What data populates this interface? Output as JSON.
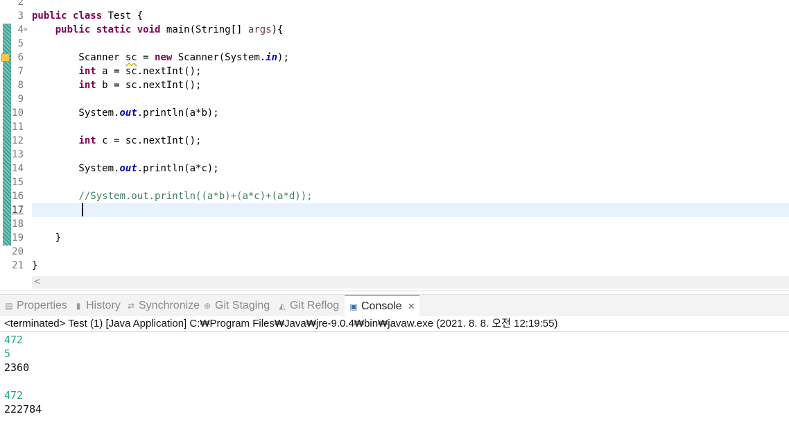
{
  "editor": {
    "lines": [
      {
        "num": "2",
        "code": ""
      },
      {
        "num": "3",
        "code": "public class Test {"
      },
      {
        "num": "4",
        "code": "    public static void main(String[] args){"
      },
      {
        "num": "5",
        "code": ""
      },
      {
        "num": "6",
        "code": "        Scanner sc = new Scanner(System.in);"
      },
      {
        "num": "7",
        "code": "        int a = sc.nextInt();"
      },
      {
        "num": "8",
        "code": "        int b = sc.nextInt();"
      },
      {
        "num": "9",
        "code": ""
      },
      {
        "num": "10",
        "code": "        System.out.println(a*b);"
      },
      {
        "num": "11",
        "code": ""
      },
      {
        "num": "12",
        "code": "        int c = sc.nextInt();"
      },
      {
        "num": "13",
        "code": ""
      },
      {
        "num": "14",
        "code": "        System.out.println(a*c);"
      },
      {
        "num": "15",
        "code": ""
      },
      {
        "num": "16",
        "code": "        //System.out.println((a*b)+(a*c)+(a*d));"
      },
      {
        "num": "17",
        "code": ""
      },
      {
        "num": "18",
        "code": ""
      },
      {
        "num": "19",
        "code": "    }"
      },
      {
        "num": "20",
        "code": ""
      },
      {
        "num": "21",
        "code": "}"
      }
    ],
    "current_line": "17",
    "scroll_left_arrow": "<",
    "colors": {
      "keyword": "#7f0055",
      "static_field": "#0000c0",
      "comment": "#3f7f5f",
      "current_line_bg": "#e8f2fe",
      "change_ruler": "#3f9d91"
    }
  },
  "tabs": [
    {
      "label": "Properties",
      "icon": "properties-icon",
      "glyph": "▤"
    },
    {
      "label": "History",
      "icon": "history-icon",
      "glyph": "▮"
    },
    {
      "label": "Synchronize",
      "icon": "synchronize-icon",
      "glyph": "⇄"
    },
    {
      "label": "Git Staging",
      "icon": "git-staging-icon",
      "glyph": "⊕"
    },
    {
      "label": "Git Reflog",
      "icon": "git-reflog-icon",
      "glyph": "◭"
    },
    {
      "label": "Console",
      "icon": "console-icon",
      "glyph": "▣",
      "active": true
    }
  ],
  "console": {
    "header": "<terminated> Test (1) [Java Application] C:₩Program Files₩Java₩jre-9.0.4₩bin₩javaw.exe (2021. 8. 8. 오전 12:19:55)",
    "output": [
      {
        "text": "472",
        "kind": "input"
      },
      {
        "text": "5",
        "kind": "input"
      },
      {
        "text": "2360",
        "kind": "stdout"
      },
      {
        "text": "",
        "kind": "stdout"
      },
      {
        "text": "472",
        "kind": "input"
      },
      {
        "text": "222784",
        "kind": "stdout"
      }
    ],
    "input_color": "#1fa87c"
  }
}
